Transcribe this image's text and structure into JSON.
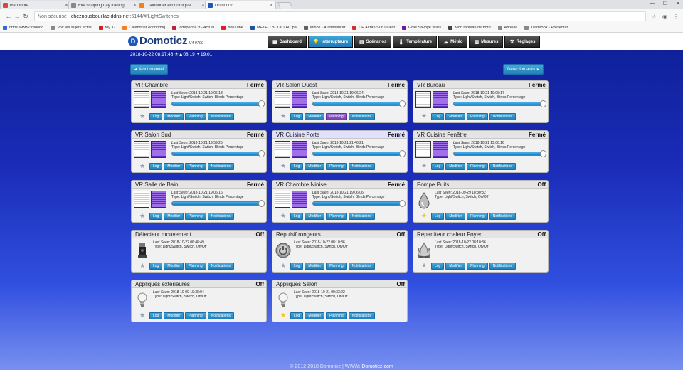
{
  "browser": {
    "tabs": [
      {
        "title": "Répondre",
        "color": "#d44a3a",
        "active": false
      },
      {
        "title": "File scalping day trading",
        "color": "#888888",
        "active": false
      },
      {
        "title": "Calendrier économique",
        "color": "#f08020",
        "active": false
      },
      {
        "title": "Domoticz",
        "color": "#1c58b8",
        "active": true
      }
    ],
    "not_secure": "Non sécurisé",
    "url_host": "cheznousbouillac.ddns.net",
    "url_path": ":6144/#/LightSwitches",
    "bookmarks": [
      {
        "label": "https://www.tradebo",
        "color": "#3367d6"
      },
      {
        "label": "Voir les sujets actifs",
        "color": "#888888"
      },
      {
        "label": "My IG",
        "color": "#d02020"
      },
      {
        "label": "Calendrier économiq",
        "color": "#f08020"
      },
      {
        "label": "ladepeche.fr - Actual",
        "color": "#c02040"
      },
      {
        "label": "YouTube",
        "color": "#e02020"
      },
      {
        "label": "METEO BOUILLAC pa",
        "color": "#2050a0"
      },
      {
        "label": "Minos - Authentificat",
        "color": "#606060"
      },
      {
        "label": "CE Altran Sud Ouest",
        "color": "#d03030"
      },
      {
        "label": "Gras Savoye Willis",
        "color": "#6a1b9a"
      },
      {
        "label": "Mon tableau de bord",
        "color": "#444444"
      },
      {
        "label": "Arkevia",
        "color": "#888888"
      },
      {
        "label": "TradeBox - Présentat",
        "color": "#888888"
      }
    ]
  },
  "app": {
    "logo": "Domoticz",
    "version": "V4.9700",
    "menu": [
      {
        "label": "Dashboard",
        "icon": "▦",
        "active": false
      },
      {
        "label": "Interrupteurs",
        "icon": "💡",
        "active": true
      },
      {
        "label": "Scénarios",
        "icon": "▤",
        "active": false
      },
      {
        "label": "Température",
        "icon": "🌡",
        "active": false
      },
      {
        "label": "Météo",
        "icon": "☁",
        "active": false
      },
      {
        "label": "Mesures",
        "icon": "▥",
        "active": false
      },
      {
        "label": "Réglages",
        "icon": "⚒",
        "active": false
      }
    ],
    "datetime": "2018-10-22 08:17:46",
    "sunrise": "08:19",
    "sunset": "19:01",
    "add_manual": "Ajout manuel",
    "auto_detect": "Détection auto",
    "footer_prefix": "© 2012-2018 Domoticz | WWW:",
    "footer_link": "Domoticz.com"
  },
  "buttons": {
    "log": "Log",
    "edit": "Modifier",
    "planning": "Planning",
    "notifications": "Notifications"
  },
  "devices": [
    {
      "name": "VR Chambre",
      "status": "Fermé",
      "type": "blind",
      "last_seen": "2018-10-21 19:06:18",
      "dtype": "Light/Switch, Switch, Blinds Percentage",
      "fav": false
    },
    {
      "name": "VR Salon Ouest",
      "status": "Fermé",
      "type": "blind",
      "last_seen": "2018-10-21 19:06:24",
      "dtype": "Light/Switch, Switch, Blinds Percentage",
      "fav": false,
      "planning_active": true
    },
    {
      "name": "VR Bureau",
      "status": "Fermé",
      "type": "blind",
      "last_seen": "2018-10-21 19:06:17",
      "dtype": "Light/Switch, Switch, Blinds Percentage",
      "fav": false
    },
    {
      "name": "VR Salon Sud",
      "status": "Fermé",
      "type": "blind",
      "last_seen": "2018-10-21 19:59:25",
      "dtype": "Light/Switch, Switch, Blinds Percentage",
      "fav": false
    },
    {
      "name": "VR Cuisine Porte",
      "status": "Fermé",
      "type": "blind",
      "last_seen": "2018-10-21 21:46:21",
      "dtype": "Light/Switch, Switch, Blinds Percentage",
      "fav": false
    },
    {
      "name": "VR Cuisine Fenêtre",
      "status": "Fermé",
      "type": "blind",
      "last_seen": "2018-10-21 19:06:16",
      "dtype": "Light/Switch, Switch, Blinds Percentage",
      "fav": false
    },
    {
      "name": "VR Salle de Bain",
      "status": "Fermé",
      "type": "blind",
      "last_seen": "2018-10-21 19:06:16",
      "dtype": "Light/Switch, Switch, Blinds Percentage",
      "fav": false
    },
    {
      "name": "VR Chambre Ninise",
      "status": "Fermé",
      "type": "blind",
      "last_seen": "2018-10-21 19:06:06",
      "dtype": "Light/Switch, Switch, Blinds Percentage",
      "fav": false
    },
    {
      "name": "Pompe Puits",
      "status": "Off",
      "type": "drop",
      "last_seen": "2018-09-29 18:30:32",
      "dtype": "Light/Switch, Switch, On/Off",
      "fav": true
    },
    {
      "name": "Détecteur mouvement",
      "status": "Off",
      "type": "sensor",
      "last_seen": "2018-10-22 06:48:49",
      "dtype": "Light/Switch, Switch, On/Off",
      "fav": false
    },
    {
      "name": "Répulsif rongeurs",
      "status": "Off",
      "type": "power",
      "last_seen": "2018-10-22 08:10:36",
      "dtype": "Light/Switch, Switch, On/Off",
      "fav": false
    },
    {
      "name": "Répartiteur chaleur Foyer",
      "status": "Off",
      "type": "fire",
      "last_seen": "2018-10-22 08:10:36",
      "dtype": "Light/Switch, Switch, On/Off",
      "fav": false
    },
    {
      "name": "Appliques extérieures",
      "status": "Off",
      "type": "bulb",
      "last_seen": "2018-10-09 19:38:04",
      "dtype": "Light/Switch, Switch, On/Off",
      "fav": false
    },
    {
      "name": "Appliques Salon",
      "status": "Off",
      "type": "bulb",
      "last_seen": "2018-10-21 00:33:22",
      "dtype": "Light/Switch, Switch, On/Off",
      "fav": true
    }
  ],
  "labels": {
    "last_seen": "Last Seen:",
    "type": "Type:"
  }
}
